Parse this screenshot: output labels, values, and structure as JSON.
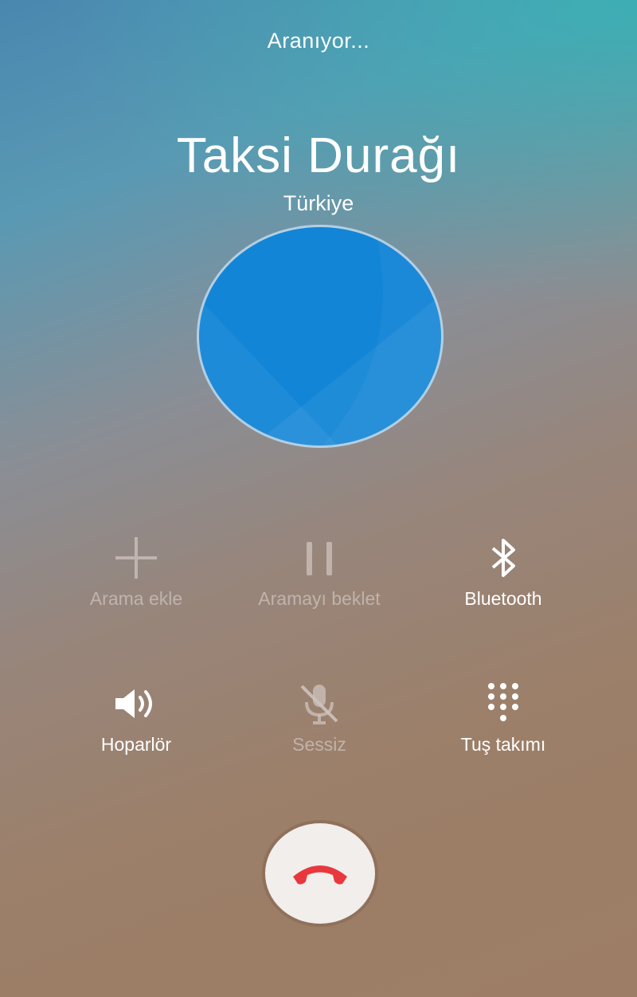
{
  "call": {
    "status": "Aranıyor...",
    "contact_name": "Taksi Durağı",
    "location": "Türkiye"
  },
  "actions": [
    {
      "label": "Arama ekle",
      "icon": "add-icon",
      "enabled": false
    },
    {
      "label": "Aramayı beklet",
      "icon": "pause-icon",
      "enabled": false
    },
    {
      "label": "Bluetooth",
      "icon": "bluetooth-icon",
      "enabled": true
    },
    {
      "label": "Hoparlör",
      "icon": "speaker-icon",
      "enabled": true
    },
    {
      "label": "Sessiz",
      "icon": "mic-off-icon",
      "enabled": false
    },
    {
      "label": "Tuş takımı",
      "icon": "dialpad-icon",
      "enabled": true
    }
  ],
  "end_call": {
    "icon": "end-call-icon",
    "color": "#e8383d"
  },
  "colors": {
    "avatar": "#1285d6",
    "end_button_bg": "#f1eeec",
    "text": "#ffffff"
  }
}
